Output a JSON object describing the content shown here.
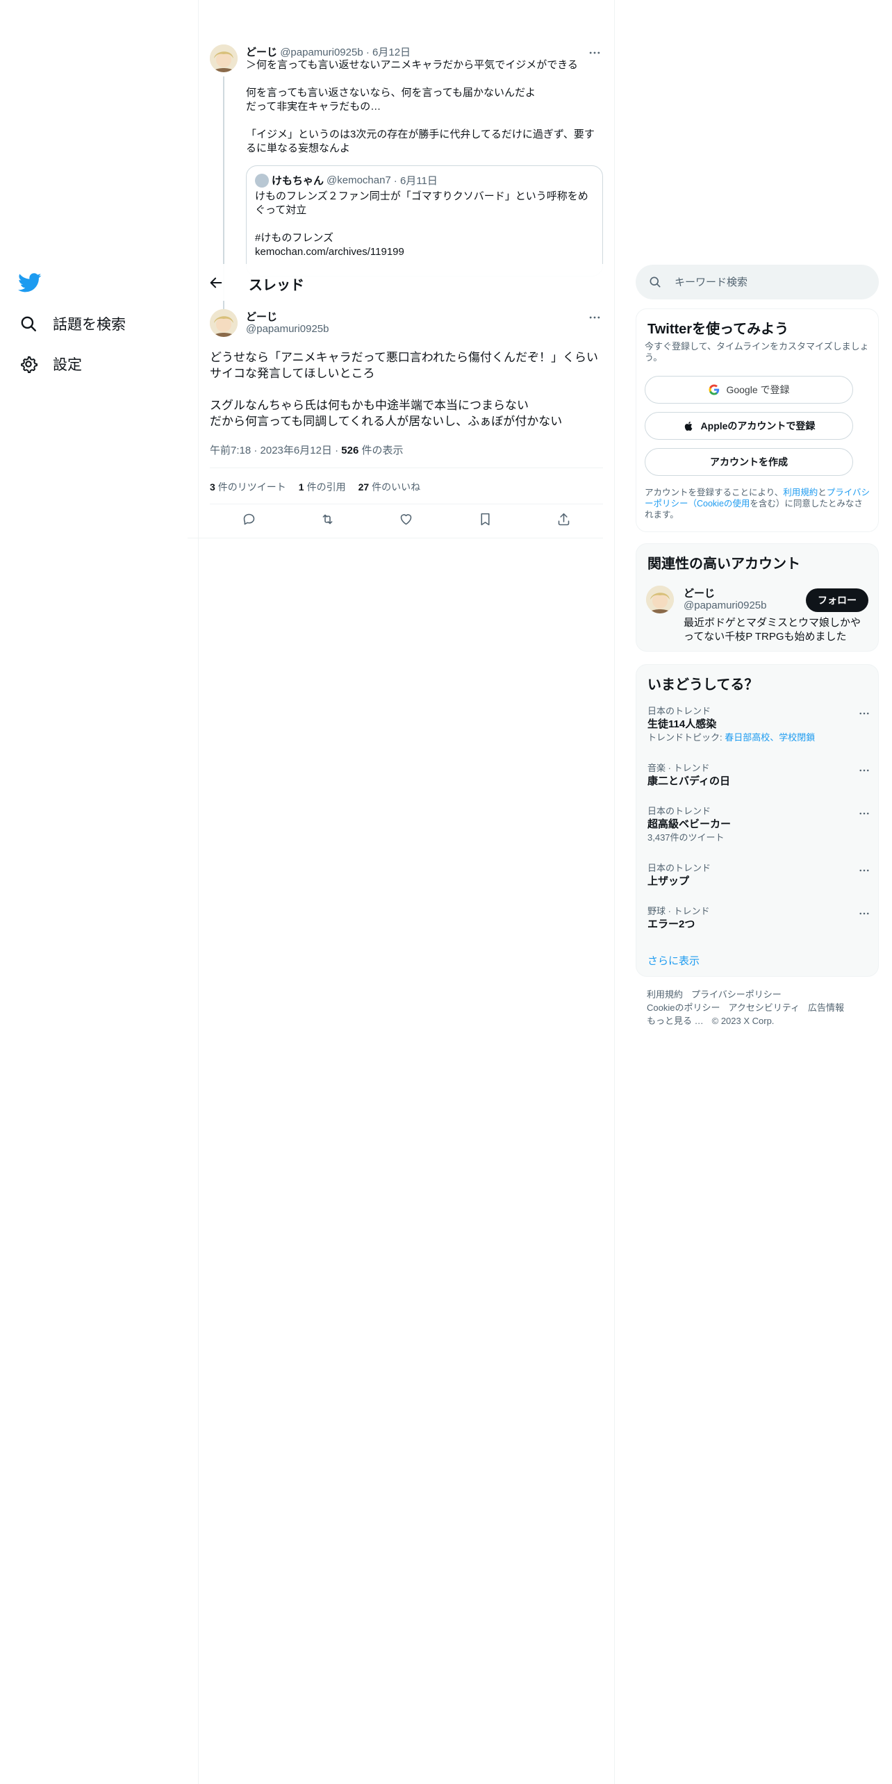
{
  "nav": {
    "items": [
      {
        "label": "話題を検索",
        "icon": "search-icon"
      },
      {
        "label": "設定",
        "icon": "gear-icon"
      }
    ],
    "brand_color": "#1d9bf0"
  },
  "parent_tweet": {
    "name": "どーじ",
    "handle": "@papamuri0925b",
    "date": "· 6月12日",
    "paragraphs": [
      "＞何を言っても言い返せないアニメキャラだから平気でイジメができる",
      "何を言っても言い返さないなら、何を言っても届かないんだよ\nだって非実在キャラだもの…",
      "「イジメ」というのは3次元の存在が勝手に代弁してるだけに過ぎず、要するに単なる妄想なんよ"
    ],
    "quote": {
      "name": "けもちゃん",
      "handle": "@kemochan7",
      "date": "· 6月11日",
      "text": "けものフレンズ２ファン同士が「ゴマすりクソバード」という呼称をめぐって対立\n\n#けものフレンズ\nkemochan.com/archives/119199"
    }
  },
  "header": {
    "title": "スレッド"
  },
  "main_tweet": {
    "name": "どーじ",
    "handle": "@papamuri0925b",
    "paragraphs": [
      "どうせなら「アニメキャラだって悪口言われたら傷付くんだぞ！」くらいサイコな発言してほしいところ",
      "スグルなんちゃら氏は何もかも中途半端で本当につまらない\nだから何言っても同調してくれる人が居ないし、ふぁぼが付かない"
    ],
    "time": "午前7:18 · 2023年6月12日 · ",
    "views_count": "526",
    "views_label": " 件の表示",
    "stats": [
      {
        "count": "3",
        "label": "件のリツイート"
      },
      {
        "count": "1",
        "label": "件の引用"
      },
      {
        "count": "27",
        "label": "件のいいね"
      }
    ]
  },
  "search": {
    "placeholder": "キーワード検索"
  },
  "signup": {
    "title": "Twitterを使ってみよう",
    "subtitle": "今すぐ登録して、タイムラインをカスタマイズしましょう。",
    "google_label": "Google で登録",
    "apple_label": "Appleのアカウントで登録",
    "create_label": "アカウントを作成",
    "legal_prefix": "アカウントを登録することにより、",
    "legal_terms": "利用規約",
    "legal_and": "と",
    "legal_privacy": "プライバシーポリシー（Cookieの使用",
    "legal_suffix": "を含む）に同意したとみなされます。"
  },
  "relevant": {
    "title": "関連性の高いアカウント",
    "name": "どーじ",
    "handle": "@papamuri0925b",
    "bio": "最近ボドゲとマダミスとウマ娘しかやってない千枝P TRPGも始めました",
    "follow_label": "フォロー"
  },
  "trends": {
    "title": "いまどうしてる？",
    "items": [
      {
        "context": "日本のトレンド",
        "name": "生徒114人感染",
        "extra_label": "トレンドトピック: ",
        "extra_link": "春日部高校、学校閉鎖"
      },
      {
        "context": "音楽 · トレンド",
        "name": "康二とバディの日"
      },
      {
        "context": "日本のトレンド",
        "name": "超高級ベビーカー",
        "extra": "3,437件のツイート"
      },
      {
        "context": "日本のトレンド",
        "name": "上ザップ"
      },
      {
        "context": "野球 · トレンド",
        "name": "エラー2つ"
      }
    ],
    "show_more": "さらに表示"
  },
  "footer": {
    "row1": [
      "利用規約",
      "プライバシーポリシー"
    ],
    "row2": [
      "Cookieのポリシー",
      "アクセシビリティ",
      "広告情報"
    ],
    "row3": [
      "もっと見る …",
      "© 2023 X Corp."
    ]
  }
}
